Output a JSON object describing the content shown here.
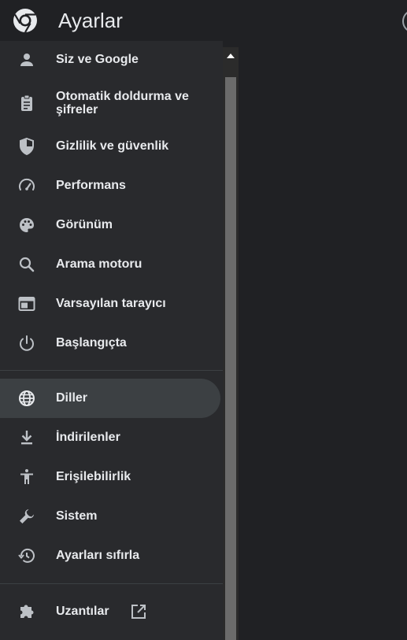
{
  "header": {
    "title": "Ayarlar",
    "logo_icon": "chrome-logo-icon"
  },
  "sidebar": {
    "items": [
      {
        "label": "Siz ve Google",
        "icon": "person-icon"
      },
      {
        "label": "Otomatik doldurma ve şifreler",
        "icon": "clipboard-icon"
      },
      {
        "label": "Gizlilik ve güvenlik",
        "icon": "shield-icon"
      },
      {
        "label": "Performans",
        "icon": "speedometer-icon"
      },
      {
        "label": "Görünüm",
        "icon": "palette-icon"
      },
      {
        "label": "Arama motoru",
        "icon": "search-icon"
      },
      {
        "label": "Varsayılan tarayıcı",
        "icon": "browser-window-icon"
      },
      {
        "label": "Başlangıçta",
        "icon": "power-icon"
      },
      {
        "label": "Diller",
        "icon": "globe-icon",
        "selected": true
      },
      {
        "label": "İndirilenler",
        "icon": "download-icon"
      },
      {
        "label": "Erişilebilirlik",
        "icon": "accessibility-icon"
      },
      {
        "label": "Sistem",
        "icon": "wrench-icon"
      },
      {
        "label": "Ayarları sıfırla",
        "icon": "history-icon"
      },
      {
        "label": "Uzantılar",
        "icon": "puzzle-icon",
        "external_icon": "open-in-new-icon"
      }
    ]
  },
  "colors": {
    "background": "#202124",
    "sidebar": "#292a2d",
    "selected": "#3c4043",
    "text": "#e8eaed",
    "icon": "#bdc1c6",
    "scroll_thumb": "#6b6b6b"
  }
}
